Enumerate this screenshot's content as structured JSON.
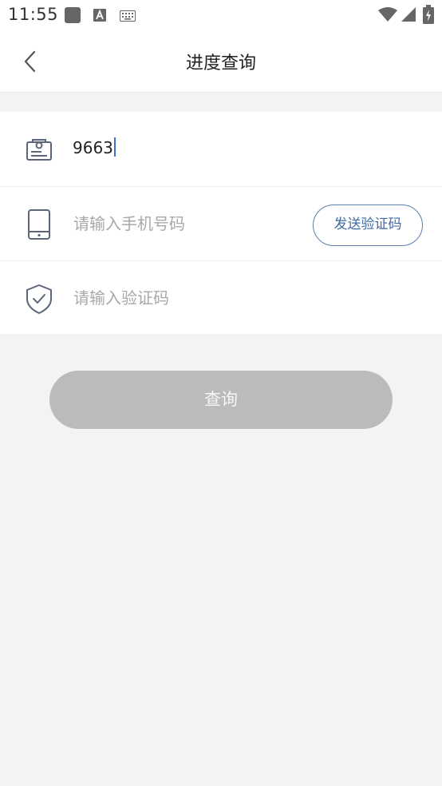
{
  "status_bar": {
    "time": "11:55",
    "icons": [
      "app-notification-icon",
      "text-a-icon",
      "keyboard-icon",
      "wifi-icon",
      "signal-icon",
      "battery-charging-icon"
    ]
  },
  "nav": {
    "title": "进度查询",
    "back_icon": "chevron-left-icon"
  },
  "form": {
    "id_field": {
      "icon": "id-card-icon",
      "value": "9663"
    },
    "phone_field": {
      "icon": "phone-icon",
      "placeholder": "请输入手机号码"
    },
    "send_code_label": "发送验证码",
    "code_field": {
      "icon": "shield-check-icon",
      "placeholder": "请输入验证码"
    }
  },
  "query_button_label": "查询",
  "colors": {
    "accent": "#3f6aa4",
    "icon": "#5a6678",
    "button_disabled": "#bbbbbb",
    "background": "#f3f3f3"
  }
}
